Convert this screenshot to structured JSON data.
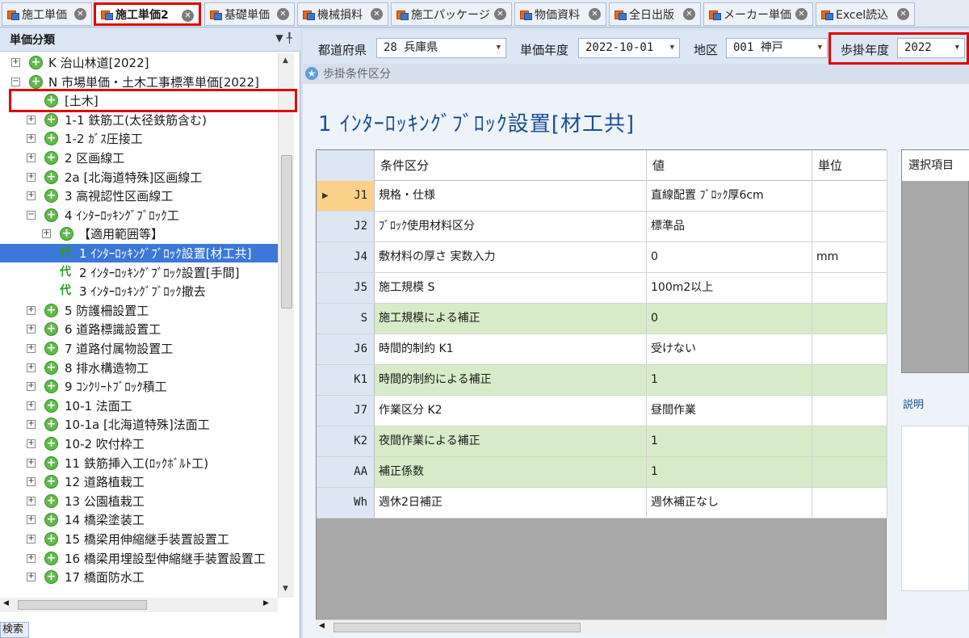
{
  "tabs": [
    {
      "label": "施工単価"
    },
    {
      "label": "施工単価2"
    },
    {
      "label": "基礎単価"
    },
    {
      "label": "機械損料"
    },
    {
      "label": "施工パッケージ"
    },
    {
      "label": "物価資料"
    },
    {
      "label": "全日出版"
    },
    {
      "label": "メーカー単価"
    },
    {
      "label": "Excel読込"
    }
  ],
  "left_panel": {
    "header": "単価分類",
    "header_icons": "▼ ╀",
    "search_label": "検索",
    "tree": [
      {
        "label": "K 治山林道[2022]",
        "icon": "green"
      },
      {
        "label": "N 市場単価・土木工事標準単価[2022]",
        "icon": "green"
      },
      {
        "label": "[土木]",
        "icon": "green"
      },
      {
        "label": "1-1 鉄筋工(太径鉄筋含む)",
        "icon": "green"
      },
      {
        "label": "1-2 ｶﾞｽ圧接工",
        "icon": "green"
      },
      {
        "label": "2 区画線工",
        "icon": "green"
      },
      {
        "label": "2a [北海道特殊]区画線工",
        "icon": "green"
      },
      {
        "label": "3 高視認性区画線工",
        "icon": "green"
      },
      {
        "label": "4 ｲﾝﾀｰﾛｯｷﾝｸﾞﾌﾞﾛｯｸ工",
        "icon": "green"
      },
      {
        "label": "【適用範囲等】",
        "icon": "green"
      },
      {
        "label": "1 ｲﾝﾀｰﾛｯｷﾝｸﾞﾌﾞﾛｯｸ設置[材工共]",
        "icon": "k"
      },
      {
        "label": "2 ｲﾝﾀｰﾛｯｷﾝｸﾞﾌﾞﾛｯｸ設置[手間]",
        "icon": "k"
      },
      {
        "label": "3 ｲﾝﾀｰﾛｯｷﾝｸﾞﾌﾞﾛｯｸ撤去",
        "icon": "k"
      },
      {
        "label": "5 防護柵設置工",
        "icon": "green"
      },
      {
        "label": "6 道路標識設置工",
        "icon": "green"
      },
      {
        "label": "7 道路付属物設置工",
        "icon": "green"
      },
      {
        "label": "8 排水構造物工",
        "icon": "green"
      },
      {
        "label": "9 ｺﾝｸﾘｰﾄﾌﾞﾛｯｸ積工",
        "icon": "green"
      },
      {
        "label": "10-1 法面工",
        "icon": "green"
      },
      {
        "label": "10-1a [北海道特殊]法面工",
        "icon": "green"
      },
      {
        "label": "10-2 吹付枠工",
        "icon": "green"
      },
      {
        "label": "11 鉄筋挿入工(ﾛｯｸﾎﾞﾙﾄ工)",
        "icon": "green"
      },
      {
        "label": "12 道路植栽工",
        "icon": "green"
      },
      {
        "label": "13 公園植栽工",
        "icon": "green"
      },
      {
        "label": "14 橋梁塗装工",
        "icon": "green"
      },
      {
        "label": "15 橋梁用伸縮継手装置設置工",
        "icon": "green"
      },
      {
        "label": "16 橋梁用埋設型伸縮継手装置設置工",
        "icon": "green"
      },
      {
        "label": "17 橋面防水工",
        "icon": "green"
      }
    ]
  },
  "filters": {
    "pref_label": "都道府県",
    "pref_value": "28 兵庫県",
    "year_label": "単価年度",
    "year_value": "2022-10-01",
    "area_label": "地区",
    "area_value": "001 神戸",
    "rate_year_label": "歩掛年度",
    "rate_year_value": "2022"
  },
  "condition_tab": "歩掛条件区分",
  "title": "1 ｲﾝﾀｰﾛｯｷﾝｸﾞﾌﾞﾛｯｸ設置[材工共]",
  "grid": {
    "headers": [
      "条件区分",
      "値",
      "単位"
    ],
    "rows": [
      {
        "code": "J1",
        "cond": "規格・仕様",
        "value": "直線配置 ﾌﾞﾛｯｸ厚6cm",
        "unit": "",
        "green": false
      },
      {
        "code": "J2",
        "cond": "ﾌﾞﾛｯｸ使用材料区分",
        "value": "標準品",
        "unit": "",
        "green": false
      },
      {
        "code": "J4",
        "cond": "敷材料の厚さ 実数入力",
        "value": "0",
        "unit": "mm",
        "green": false
      },
      {
        "code": "J5",
        "cond": "施工規模 S",
        "value": "100m2以上",
        "unit": "",
        "green": false
      },
      {
        "code": "S",
        "cond": "施工規模による補正",
        "value": "0",
        "unit": "",
        "green": true
      },
      {
        "code": "J6",
        "cond": "時間的制約 K1",
        "value": "受けない",
        "unit": "",
        "green": false
      },
      {
        "code": "K1",
        "cond": "時間的制約による補正",
        "value": "1",
        "unit": "",
        "green": true
      },
      {
        "code": "J7",
        "cond": "作業区分 K2",
        "value": "昼間作業",
        "unit": "",
        "green": false
      },
      {
        "code": "K2",
        "cond": "夜間作業による補正",
        "value": "1",
        "unit": "",
        "green": true
      },
      {
        "code": "AA",
        "cond": "補正係数",
        "value": "1",
        "unit": "",
        "green": true
      },
      {
        "code": "Wh",
        "cond": "週休2日補正",
        "value": "週休補正なし",
        "unit": "",
        "green": false
      }
    ]
  },
  "side": {
    "header": "選択項目",
    "desc_label": "説明"
  }
}
